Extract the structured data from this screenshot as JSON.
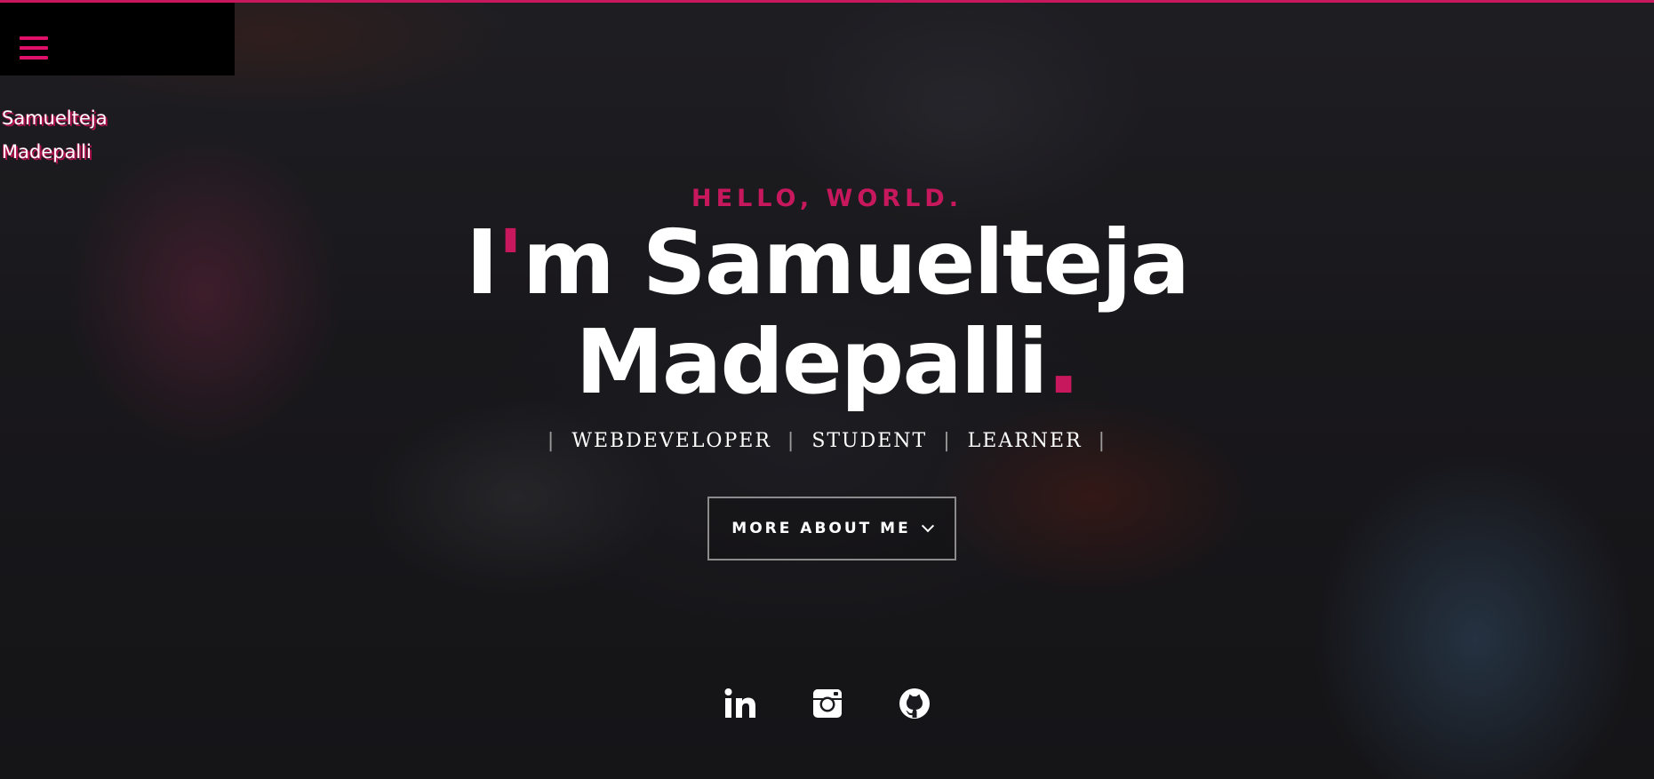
{
  "theme": {
    "accent": "#c8185d",
    "text": "#ffffff"
  },
  "menu": {
    "icon": "hamburger-menu-icon"
  },
  "brand": {
    "first_name": "Samuelteja",
    "last_name": "Madepalli"
  },
  "hero": {
    "greeting": "HELLO, WORLD.",
    "headline_prefix": "I",
    "headline_apostrophe": "'",
    "headline_line1_rest": "m Samuelteja",
    "headline_line2": "Madepalli",
    "headline_dot": ".",
    "roles": [
      "WEBDEVELOPER",
      "STUDENT",
      "LEARNER"
    ],
    "separator": "|",
    "button_label": "MORE ABOUT ME",
    "button_icon": "chevron-down-icon"
  },
  "social": [
    {
      "name": "linkedin",
      "icon": "linkedin-icon"
    },
    {
      "name": "instagram",
      "icon": "instagram-icon"
    },
    {
      "name": "github",
      "icon": "github-icon"
    }
  ]
}
